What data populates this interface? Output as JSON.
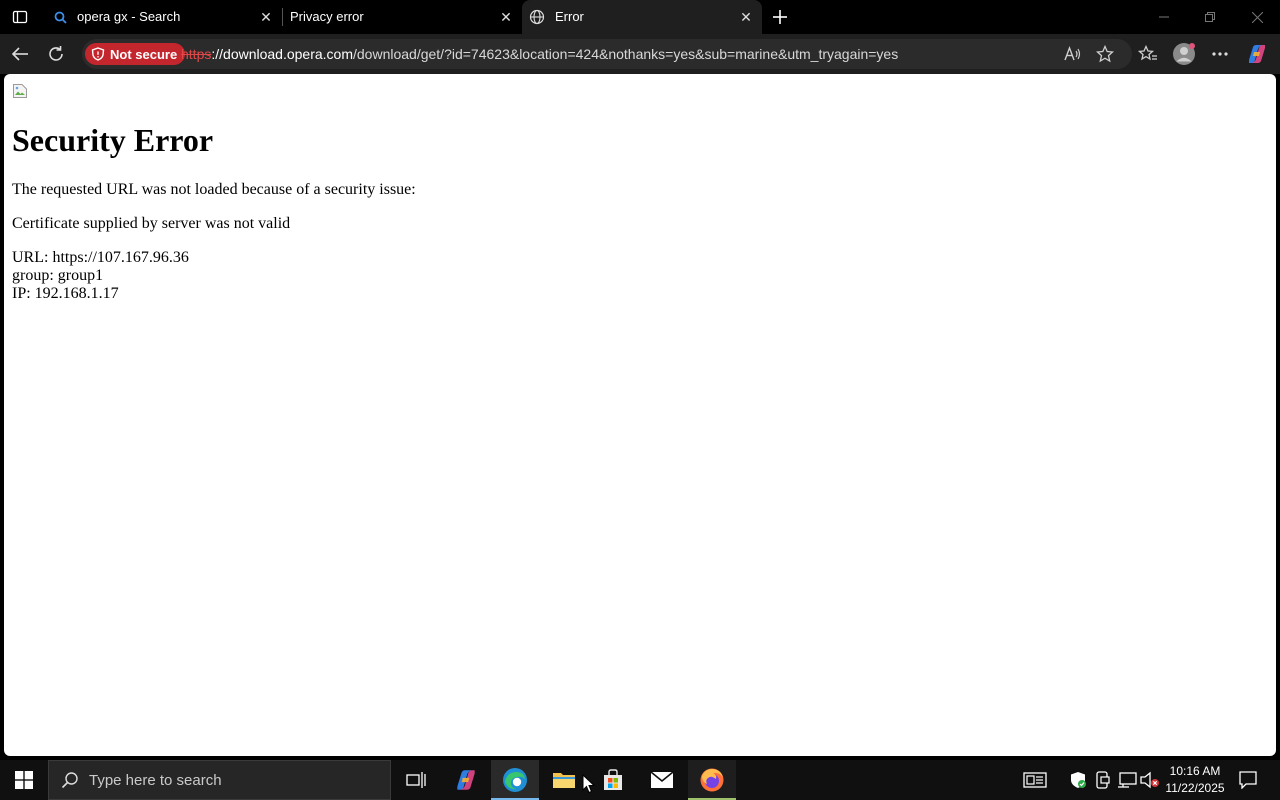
{
  "browser": {
    "tabs": [
      {
        "title": "opera gx - Search",
        "active": false
      },
      {
        "title": "Privacy error",
        "active": false
      },
      {
        "title": "Error",
        "active": true
      }
    ],
    "security_chip": "Not secure",
    "url": {
      "scheme": "https",
      "host": "://download.opera.com",
      "rest": "/download/get/?id=74623&location=424&nothanks=yes&sub=marine&utm_tryagain=yes"
    }
  },
  "page": {
    "title": "Security Error",
    "message": "The requested URL was not loaded because of a security issue:",
    "reason": "Certificate supplied by server was not valid",
    "details": {
      "url": "URL: https://107.167.96.36",
      "group": "group: group1",
      "ip": "IP: 192.168.1.17"
    }
  },
  "taskbar": {
    "search_placeholder": "Type here to search",
    "time": "10:16 AM",
    "date": "11/22/2025"
  },
  "colors": {
    "not_secure_bg": "#c4262e",
    "edge_active_indicator": "#76b9ed"
  }
}
